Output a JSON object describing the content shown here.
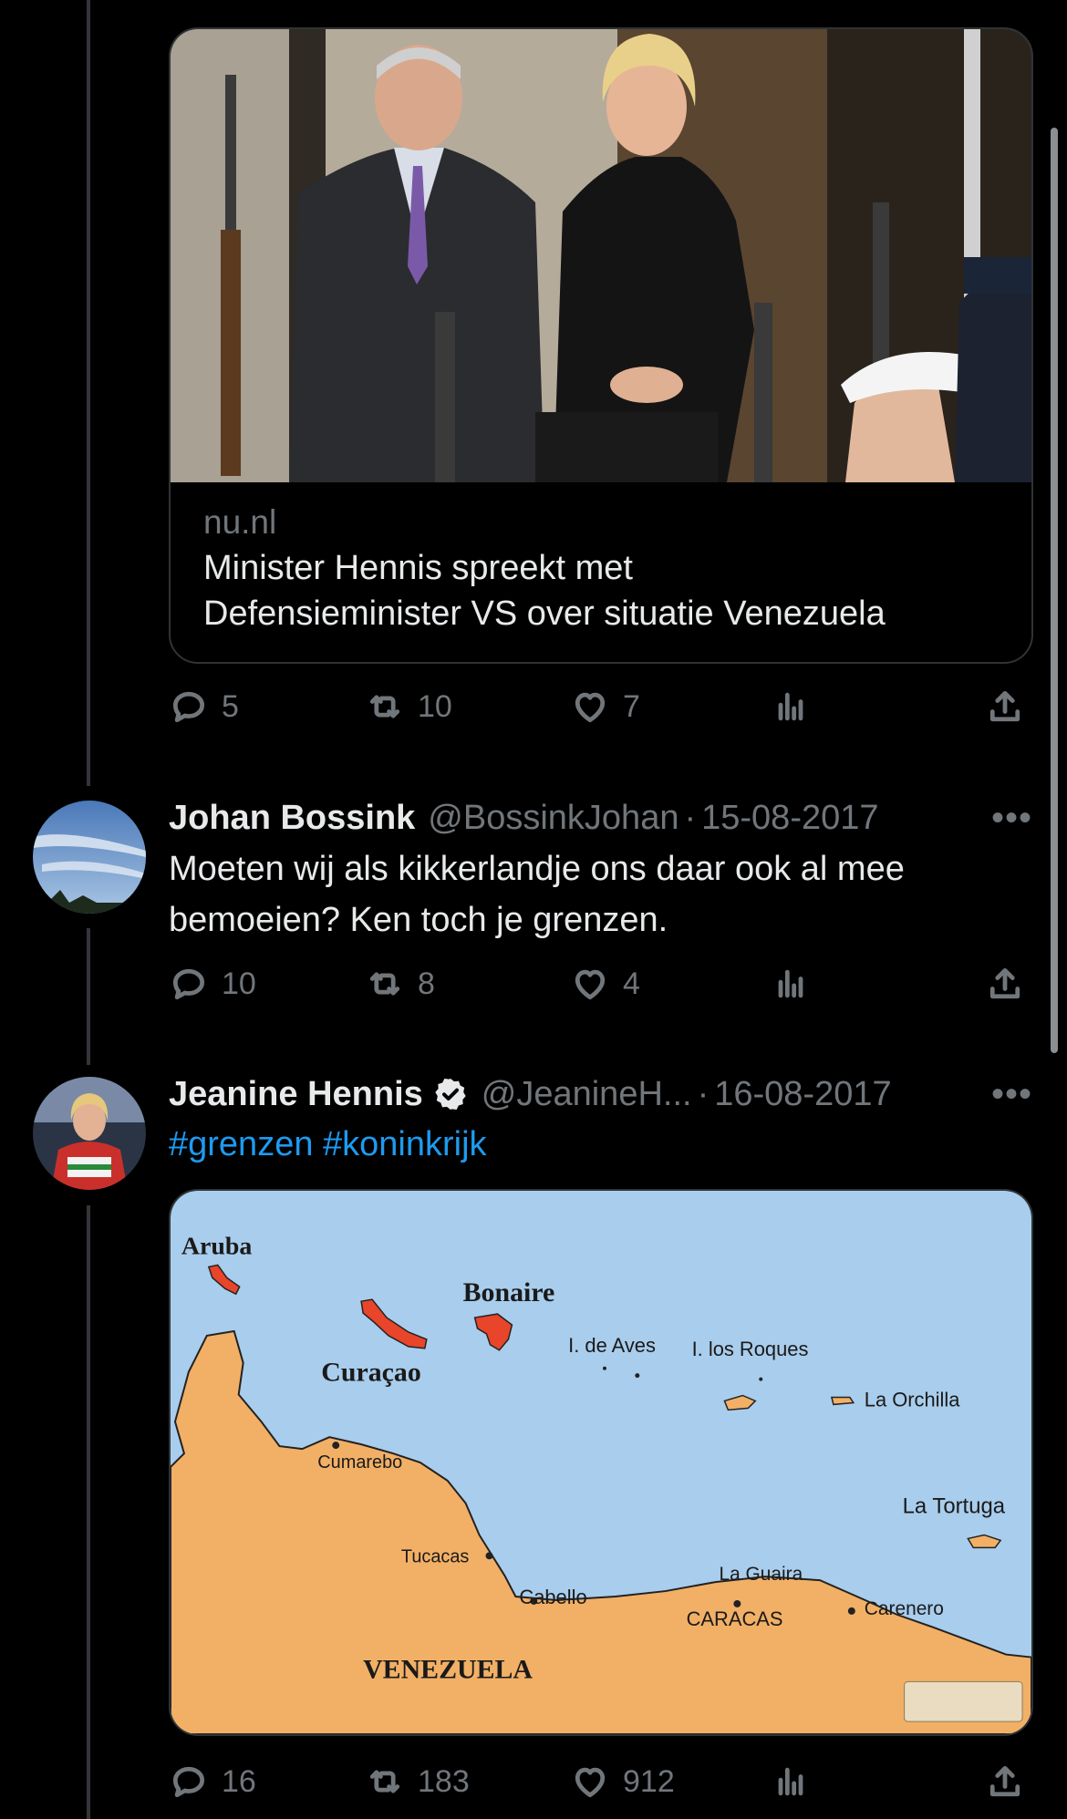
{
  "link_card": {
    "domain": "nu.nl",
    "title_line1": "Minister Hennis spreekt met",
    "title_line2": "Defensieminister VS over situatie Venezuela"
  },
  "tweet0_actions": {
    "replies": "5",
    "retweets": "10",
    "likes": "7"
  },
  "tweet1": {
    "author": "Johan Bossink",
    "handle": "@BossinkJohan",
    "separator": "·",
    "date": "15-08-2017",
    "more": "•••",
    "text_line1": "Moeten wij als kikkerlandje ons daar ook al mee",
    "text_line2": "bemoeien? Ken toch je grenzen.",
    "replies": "10",
    "retweets": "8",
    "likes": "4"
  },
  "tweet2": {
    "author": "Jeanine Hennis",
    "handle": "@JeanineH...",
    "separator": "·",
    "date": "16-08-2017",
    "more": "•••",
    "hashtags": "#grenzen #koninkrijk",
    "replies": "16",
    "retweets": "183",
    "likes": "912",
    "verified_color": "#e7e9ea"
  },
  "map": {
    "label_aruba": "Aruba",
    "label_curacao": "Curaçao",
    "label_bonaire": "Bonaire",
    "label_aves": "I. de Aves",
    "label_roques": "I. los Roques",
    "label_orchilla": "La Orchilla",
    "label_tortuga": "La Tortuga",
    "label_cumarebo": "Cumarebo",
    "label_tucacas": "Tucacas",
    "label_cabello": "Cabello",
    "label_guaira": "La Guaira",
    "label_caracas": "CARACAS",
    "label_carenero": "Carenero",
    "label_venezuela": "VENEZUELA",
    "sea_color": "#a9cdec",
    "land_color": "#f2b066",
    "island_color": "#e8452a"
  },
  "icons": [
    "reply-icon",
    "retweet-icon",
    "like-icon",
    "views-icon",
    "share-icon",
    "verified-icon"
  ],
  "colors": {
    "background": "#000000",
    "muted": "#71767b",
    "link": "#1d9bf0",
    "text": "#e7e9ea"
  }
}
